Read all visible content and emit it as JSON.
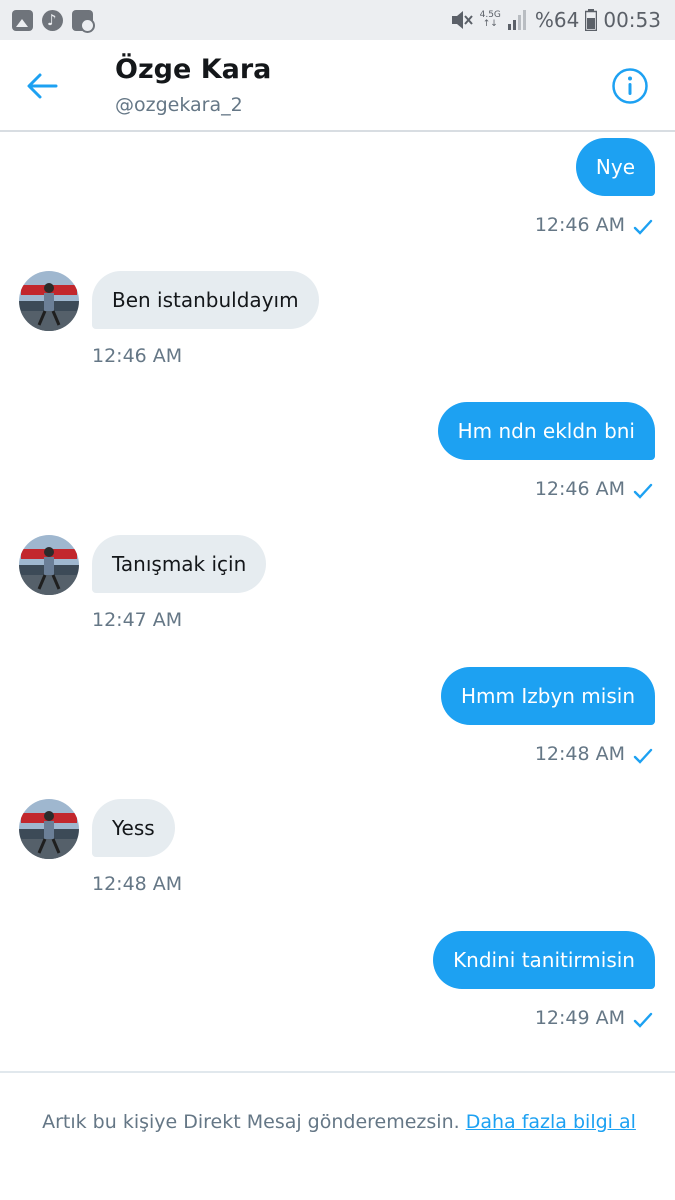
{
  "status_bar": {
    "network": "4.5G",
    "battery": "%64",
    "time": "00:53",
    "icons": [
      "gallery-icon",
      "music-icon",
      "file-icon",
      "mute-icon",
      "signal-icon",
      "battery-icon"
    ]
  },
  "header": {
    "name": "Özge Kara",
    "handle": "@ozgekara_2",
    "back_icon": "back-arrow-icon",
    "info_icon": "info-icon"
  },
  "messages": [
    {
      "direction": "sent",
      "text": "Nye",
      "time": "12:46 AM"
    },
    {
      "direction": "received",
      "text": "Ben istanbuldayım",
      "time": "12:46 AM"
    },
    {
      "direction": "sent",
      "text": "Hm ndn ekldn bni",
      "time": "12:46 AM"
    },
    {
      "direction": "received",
      "text": "Tanışmak için",
      "time": "12:47 AM"
    },
    {
      "direction": "sent",
      "text": "Hmm Izbyn misin",
      "time": "12:48 AM"
    },
    {
      "direction": "received",
      "text": "Yess",
      "time": "12:48 AM"
    },
    {
      "direction": "sent",
      "text": "Kndini tanitirmisin",
      "time": "12:49 AM"
    }
  ],
  "footer": {
    "notice": "Artık bu kişiye Direkt Mesaj gönderemezsin.",
    "link": "Daha fazla bilgi al"
  },
  "colors": {
    "accent": "#1da1f2",
    "received_bubble": "#e6ecf0",
    "secondary_text": "#657786",
    "status_bar": "#eceef1"
  }
}
